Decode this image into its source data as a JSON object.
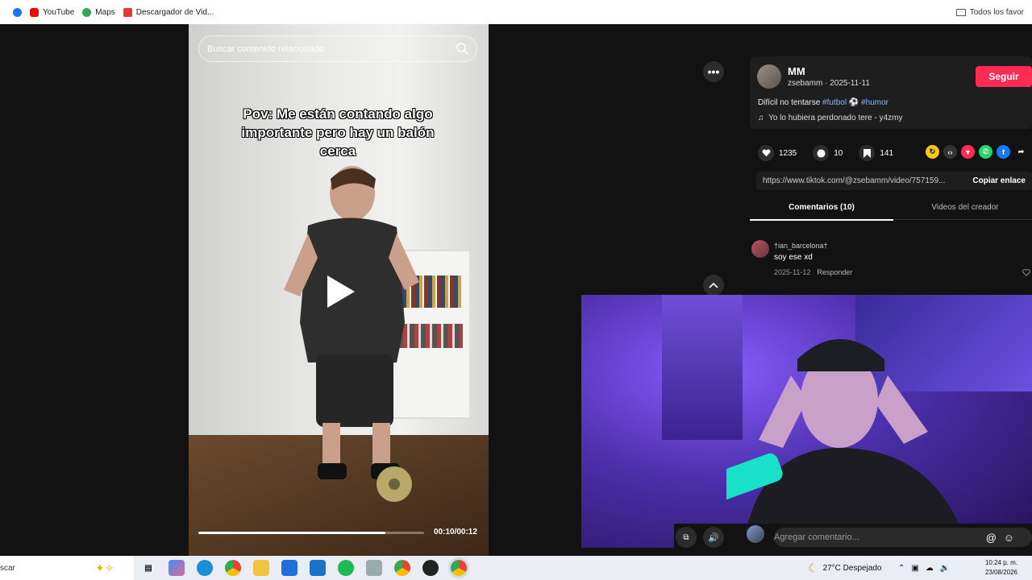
{
  "bookmarks": {
    "items": [
      {
        "label": "YouTube",
        "color": "#ff0000"
      },
      {
        "label": "Maps",
        "color": "#34a853"
      },
      {
        "label": "Descargador de Vid...",
        "color": "#e53935"
      }
    ],
    "favorites_label": "Todos los favor"
  },
  "video": {
    "search_placeholder": "Buscar contenido relacionado",
    "caption": "Pov: Me están contando algo importante pero hay un balón cerca",
    "time": "00:10/00:12",
    "progress": 0.83
  },
  "author": {
    "name": "MM",
    "handle_date": "zsebamm · 2025-11-11",
    "follow_label": "Seguir"
  },
  "description": {
    "text": "Difícil no tentarse ",
    "tag1": "#futbol",
    "tag2": "#humor",
    "music": "Yo lo hubiera perdonado tere - y4zmy"
  },
  "stats": {
    "likes": "1235",
    "comments": "10",
    "saves": "141"
  },
  "link": {
    "url": "https://www.tiktok.com/@zsebamm/video/757159...",
    "copy_label": "Copiar enlace"
  },
  "tabs": {
    "comments": "Comentarios (10)",
    "creator": "Videos del creador"
  },
  "comment": {
    "user": "†ian_barcelona†",
    "text": "soy ese xd",
    "date": "2025-11-12",
    "reply": "Responder"
  },
  "comment_bar": {
    "placeholder": "Agregar comentario...",
    "at": "@"
  },
  "taskbar": {
    "search": "scar",
    "weather": "27°C Despejado",
    "time": "10:24 p. m.",
    "date": "23/08/2026"
  }
}
